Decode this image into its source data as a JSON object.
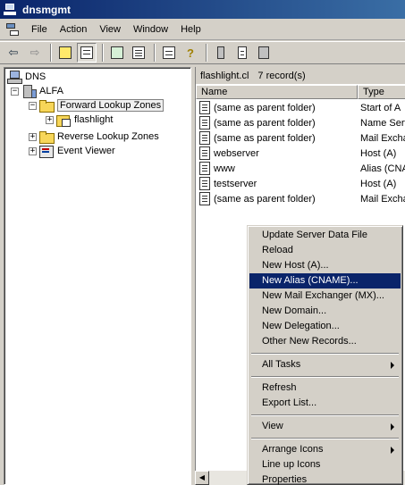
{
  "window": {
    "title": "dnsmgmt"
  },
  "menu": [
    "File",
    "Action",
    "View",
    "Window",
    "Help"
  ],
  "toolbar": {
    "buttons": [
      "back-arrow-icon",
      "forward-arrow-icon",
      "up-folder-icon",
      "show-hide-tree-icon",
      "refresh-icon",
      "export-list-icon",
      "properties-icon",
      "help-icon",
      "server-icon",
      "zone-icon",
      "record-icon"
    ]
  },
  "tree": {
    "root": "DNS",
    "server": "ALFA",
    "forward": "Forward Lookup Zones",
    "zone": "flashlight",
    "reverse": "Reverse Lookup Zones",
    "events": "Event Viewer"
  },
  "list": {
    "zone_title": "flashlight.cl",
    "record_count": "7 record(s)",
    "columns": [
      "Name",
      "Type"
    ],
    "records": [
      {
        "name": "(same as parent folder)",
        "type": "Start of A"
      },
      {
        "name": "(same as parent folder)",
        "type": "Name Serv"
      },
      {
        "name": "(same as parent folder)",
        "type": "Mail Exchan"
      },
      {
        "name": "webserver",
        "type": "Host (A)"
      },
      {
        "name": "www",
        "type": "Alias (CNA"
      },
      {
        "name": "testserver",
        "type": "Host (A)"
      },
      {
        "name": "(same as parent folder)",
        "type": "Mail Excha"
      }
    ]
  },
  "context_menu": {
    "items": [
      "Update Server Data File",
      "Reload",
      "New Host (A)...",
      "New Alias (CNAME)...",
      "New Mail Exchanger (MX)...",
      "New Domain...",
      "New Delegation...",
      "Other New Records...",
      "All Tasks",
      "Refresh",
      "Export List...",
      "View",
      "Arrange Icons",
      "Line up Icons",
      "Properties"
    ],
    "selected": "New Alias (CNAME)..."
  }
}
